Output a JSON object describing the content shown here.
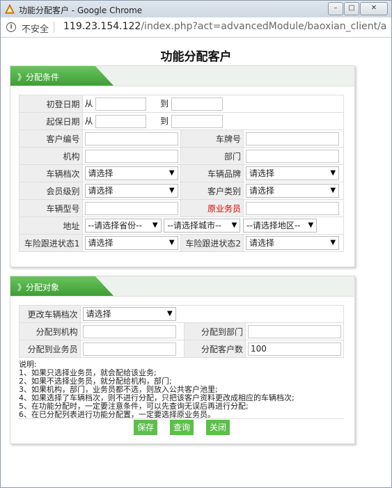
{
  "browser": {
    "window_title": "功能分配客户 - Google Chrome",
    "security_label": "不安全",
    "url_host": "119.23.154.122",
    "url_rest": "/index.php?act=advancedModule/baoxian_client/a..."
  },
  "page": {
    "title": "功能分配客户"
  },
  "conditions": {
    "section_label": "》分配条件",
    "first_register_date": {
      "label": "初登日期",
      "from": "从",
      "to": "到"
    },
    "insure_start_date": {
      "label": "起保日期",
      "from": "从",
      "to": "到"
    },
    "customer_no": {
      "label": "客户编号",
      "value": ""
    },
    "plate_no": {
      "label": "车牌号",
      "value": ""
    },
    "org": {
      "label": "机构",
      "value": ""
    },
    "dept": {
      "label": "部门",
      "value": ""
    },
    "vehicle_grade": {
      "label": "车辆档次",
      "value": "请选择"
    },
    "vehicle_brand": {
      "label": "车辆品牌",
      "value": "请选择"
    },
    "member_level": {
      "label": "会员级别",
      "value": "请选择"
    },
    "customer_type": {
      "label": "客户类别",
      "value": "请选择"
    },
    "vehicle_model": {
      "label": "车辆型号",
      "value": ""
    },
    "original_agent": {
      "label": "原业务员",
      "value": ""
    },
    "address": {
      "label": "地址",
      "province": "--请选择省份--",
      "city": "--请选择城市--",
      "district": "--请选择地区--"
    },
    "follow_status_1": {
      "label": "车险跟进状态1",
      "value": "请选择"
    },
    "follow_status_2": {
      "label": "车险跟进状态2",
      "value": "请选择"
    }
  },
  "target": {
    "section_label": "》分配对象",
    "change_grade": {
      "label": "更改车辆档次",
      "value": "请选择"
    },
    "assign_org": {
      "label": "分配到机构",
      "value": ""
    },
    "assign_dept": {
      "label": "分配到部门",
      "value": ""
    },
    "assign_agent": {
      "label": "分配到业务员",
      "value": ""
    },
    "assign_count": {
      "label": "分配客户数",
      "value": "100"
    },
    "notes_title": "说明:",
    "notes": [
      "1、如果只选择业务员，就会配给该业务;",
      "2、如果不选择业务员，就分配给机构，部门;",
      "3、如果机构，部门，业务员都不选，则放入公共客户池里;",
      "4、如果选择了车辆档次，则不进行分配，只把该客户资料更改成相应的车辆档次;",
      "5、在功能分配时，一定要注意条件，可以先查询无误后再进行分配;",
      "6、在已分配列表进行功能分配置，一定要选择原业务员。"
    ],
    "buttons": {
      "save": "保存",
      "query": "查询",
      "close": "关闭"
    }
  }
}
